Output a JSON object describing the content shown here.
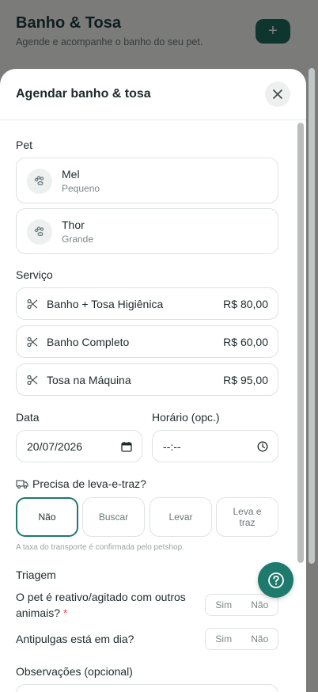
{
  "background": {
    "title": "Banho & Tosa",
    "subtitle": "Agende e acompanhe o banho do seu pet.",
    "add_label": "+"
  },
  "sheet": {
    "title": "Agendar banho & tosa",
    "pet_label": "Pet",
    "pets": [
      {
        "name": "Mel",
        "size": "Pequeno"
      },
      {
        "name": "Thor",
        "size": "Grande"
      }
    ],
    "service_label": "Serviço",
    "services": [
      {
        "name": "Banho + Tosa Higiênica",
        "price": "R$ 80,00"
      },
      {
        "name": "Banho Completo",
        "price": "R$ 60,00"
      },
      {
        "name": "Tosa na Máquina",
        "price": "R$ 95,00"
      }
    ],
    "date_label": "Data",
    "date_value": "20/07/2026",
    "time_label": "Horário (opc.)",
    "time_value": "--:--",
    "transport_label": "Precisa de leva-e-traz?",
    "transport_options": [
      "Não",
      "Buscar",
      "Levar",
      "Leva e traz"
    ],
    "transport_selected": "Não",
    "transport_hint": "A taxa do transporte é confirmada pelo petshop.",
    "triage_label": "Triagem",
    "questions": [
      {
        "text": "O pet é reativo/agitado com outros animais?",
        "required_mark": "*",
        "yes": "Sim",
        "no": "Não"
      },
      {
        "text": "Antipulgas está em dia?",
        "yes": "Sim",
        "no": "Não"
      }
    ],
    "notes_label": "Observações (opcional)"
  },
  "colors": {
    "accent": "#1d7a6c",
    "required": "#d9534f"
  },
  "icons": {
    "close": "close-icon",
    "pet": "paw-icon",
    "service": "scissors-icon",
    "calendar": "calendar-icon",
    "clock": "clock-icon",
    "truck": "truck-icon",
    "help": "help-icon"
  }
}
